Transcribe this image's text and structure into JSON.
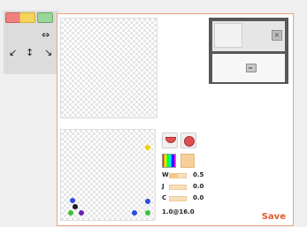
{
  "toolbar": {
    "swatches": [
      {
        "name": "swatch-red",
        "color": "#f08080"
      },
      {
        "name": "swatch-yellow",
        "color": "#f4d35e"
      },
      {
        "name": "swatch-green",
        "color": "#9ad69a"
      }
    ],
    "tools": [
      {
        "icon": "move-horizontal-icon",
        "glyph": "⇔"
      },
      {
        "icon": "arrow-down-left-icon",
        "glyph": "↙"
      },
      {
        "icon": "move-vertical-icon",
        "glyph": "↕"
      },
      {
        "icon": "arrow-down-right-icon",
        "glyph": "↘"
      }
    ]
  },
  "controls": {
    "shape_icons": [
      "half-circle-icon",
      "circle-icon"
    ],
    "color_icons": [
      "gradient-icon",
      "color-swatch-icon"
    ],
    "sliders": [
      {
        "label": "W",
        "value": "0.5",
        "fraction": 0.5
      },
      {
        "label": "J",
        "value": "0.0",
        "fraction": 0.0
      },
      {
        "label": "C",
        "value": "0.0",
        "fraction": 0.0
      }
    ],
    "ratio_text": "1.0@16.0"
  },
  "preview": {
    "icons": [
      "close-icon",
      "image-icon"
    ]
  },
  "dots": {
    "colors": [
      "#f5d000",
      "#2b4de0",
      "#2b4de0",
      "#3bc13b",
      "#2b4de0",
      "#6a1fb5",
      "#1a1a1a",
      "#3bc13b"
    ]
  },
  "save_label": "Save"
}
